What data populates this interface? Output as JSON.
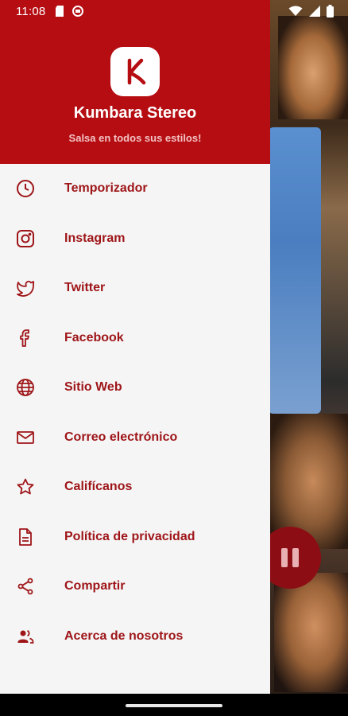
{
  "status_bar": {
    "time": "11:08"
  },
  "drawer": {
    "header": {
      "title": "Kumbara Stereo",
      "subtitle": "Salsa en todos sus estilos!",
      "logo_icon": "kumbara-k-logo"
    },
    "items": [
      {
        "label": "Temporizador",
        "icon": "clock-icon"
      },
      {
        "label": "Instagram",
        "icon": "instagram-icon"
      },
      {
        "label": "Twitter",
        "icon": "twitter-icon"
      },
      {
        "label": "Facebook",
        "icon": "facebook-icon"
      },
      {
        "label": "Sitio Web",
        "icon": "globe-icon"
      },
      {
        "label": "Correo electrónico",
        "icon": "mail-icon"
      },
      {
        "label": "Califícanos",
        "icon": "star-icon"
      },
      {
        "label": "Política de privacidad",
        "icon": "document-icon"
      },
      {
        "label": "Compartir",
        "icon": "share-icon"
      },
      {
        "label": "Acerca de nosotros",
        "icon": "people-icon"
      }
    ]
  },
  "colors": {
    "header_red": "#b50d12",
    "item_text": "#9e1518",
    "drawer_bg": "#f5f5f5"
  }
}
